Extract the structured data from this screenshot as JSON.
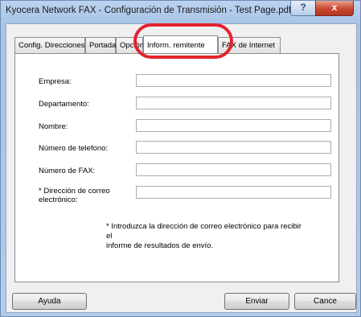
{
  "window": {
    "title": "Kyocera Network FAX - Configuración de Transmisión - Test Page.pdf",
    "help_label": "?",
    "close_label": "x"
  },
  "tabs": [
    {
      "label": "Config. Direcciones"
    },
    {
      "label": "Portada"
    },
    {
      "label": "Opción"
    },
    {
      "label": "Inform. remitente"
    },
    {
      "label": "FAX de Internet"
    }
  ],
  "form": {
    "fields": [
      {
        "label": "Empresa:",
        "value": ""
      },
      {
        "label": "Departamento:",
        "value": ""
      },
      {
        "label": "Nombre:",
        "value": ""
      },
      {
        "label": "Número de telefono:",
        "value": ""
      },
      {
        "label": "Número de FAX:",
        "value": ""
      },
      {
        "label_line1": "* Dirección de correo",
        "label_line2": "electrónico:",
        "value": ""
      }
    ],
    "note_line1": "* Introduzca la dirección de correo electrónico para recibir el",
    "note_line2": "informe de resultados de envío."
  },
  "buttons": {
    "help": "Ayuda",
    "send": "Enviar",
    "cancel": "Cance"
  },
  "colors": {
    "highlight": "#e3232b",
    "titlebar": "#b4cbe9",
    "close_button": "#c8472f"
  }
}
